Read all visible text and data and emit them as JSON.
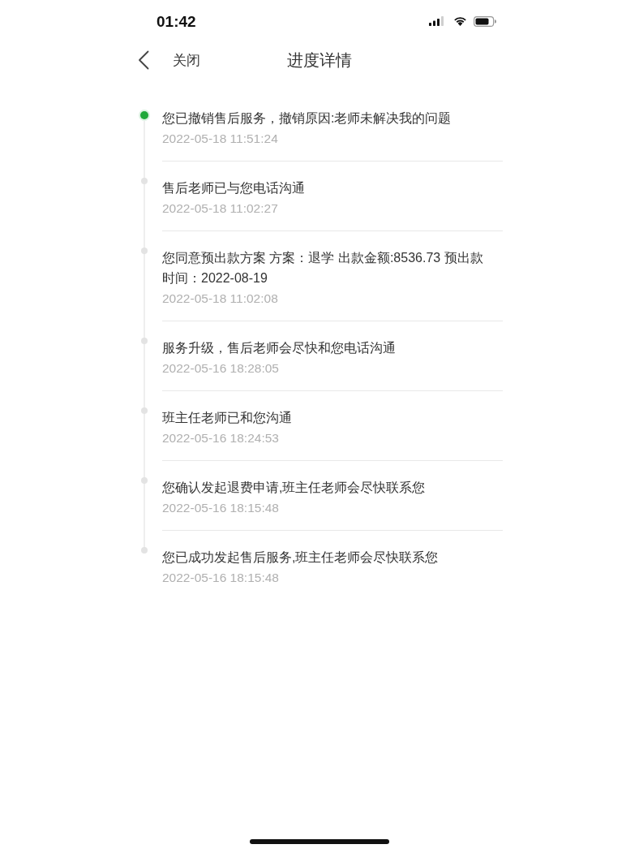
{
  "status_bar": {
    "time": "01:42"
  },
  "nav_bar": {
    "close_label": "关闭",
    "title": "进度详情"
  },
  "timeline": [
    {
      "text": "您已撤销售后服务，撤销原因:老师未解决我的问题",
      "time": "2022-05-18 11:51:24",
      "current": true
    },
    {
      "text": "售后老师已与您电话沟通",
      "time": "2022-05-18 11:02:27",
      "current": false
    },
    {
      "text": "您同意预出款方案 方案：退学 出款金额:8536.73 预出款时间：2022-08-19",
      "time": "2022-05-18 11:02:08",
      "current": false
    },
    {
      "text": "服务升级，售后老师会尽快和您电话沟通",
      "time": "2022-05-16 18:28:05",
      "current": false
    },
    {
      "text": "班主任老师已和您沟通",
      "time": "2022-05-16 18:24:53",
      "current": false
    },
    {
      "text": "您确认发起退费申请,班主任老师会尽快联系您",
      "time": "2022-05-16 18:15:48",
      "current": false
    },
    {
      "text": "您已成功发起售后服务,班主任老师会尽快联系您",
      "time": "2022-05-16 18:15:48",
      "current": false
    }
  ]
}
